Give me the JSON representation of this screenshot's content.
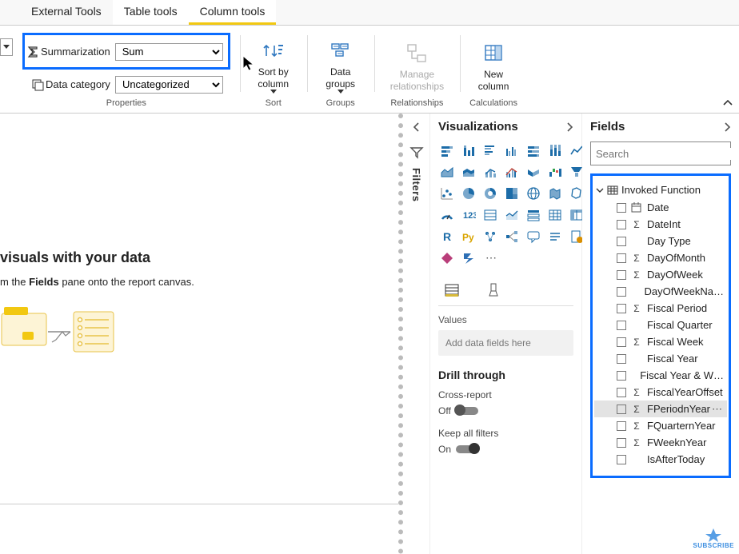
{
  "tabs": {
    "external": "External Tools",
    "table": "Table tools",
    "column": "Column tools"
  },
  "ribbon": {
    "summarization_label": "Summarization",
    "summarization_value": "Sum",
    "data_category_label": "Data category",
    "data_category_value": "Uncategorized",
    "sort_by_column": "Sort by\ncolumn",
    "data_groups": "Data\ngroups",
    "manage_rel": "Manage\nrelationships",
    "new_column": "New\ncolumn",
    "group_properties": "Properties",
    "group_sort": "Sort",
    "group_groups": "Groups",
    "group_relationships": "Relationships",
    "group_calculations": "Calculations"
  },
  "canvas": {
    "title": "visuals with your data",
    "hint_pre": "m the ",
    "hint_bold": "Fields",
    "hint_post": " pane onto the report canvas."
  },
  "filters_label": "Filters",
  "viz": {
    "title": "Visualizations",
    "values_label": "Values",
    "drop_hint": "Add data fields here",
    "drill_title": "Drill through",
    "cross_report": "Cross-report",
    "off": "Off",
    "keep_filters": "Keep all filters",
    "on": "On"
  },
  "fields": {
    "title": "Fields",
    "search_placeholder": "Search",
    "table_name": "Invoked Function",
    "items": [
      {
        "name": "Date",
        "icon": "calendar"
      },
      {
        "name": "DateInt",
        "icon": "sigma"
      },
      {
        "name": "Day Type",
        "icon": "none"
      },
      {
        "name": "DayOfMonth",
        "icon": "sigma"
      },
      {
        "name": "DayOfWeek",
        "icon": "sigma"
      },
      {
        "name": "DayOfWeekNa…",
        "icon": "none"
      },
      {
        "name": "Fiscal Period",
        "icon": "sigma"
      },
      {
        "name": "Fiscal Quarter",
        "icon": "none"
      },
      {
        "name": "Fiscal Week",
        "icon": "sigma"
      },
      {
        "name": "Fiscal Year",
        "icon": "none"
      },
      {
        "name": "Fiscal Year & W…",
        "icon": "none"
      },
      {
        "name": "FiscalYearOffset",
        "icon": "sigma"
      },
      {
        "name": "FPeriodnYear",
        "icon": "sigma",
        "selected": true
      },
      {
        "name": "FQuarternYear",
        "icon": "sigma"
      },
      {
        "name": "FWeeknYear",
        "icon": "sigma"
      },
      {
        "name": "IsAfterToday",
        "icon": "none"
      }
    ]
  },
  "subscribe": "SUBSCRIBE"
}
